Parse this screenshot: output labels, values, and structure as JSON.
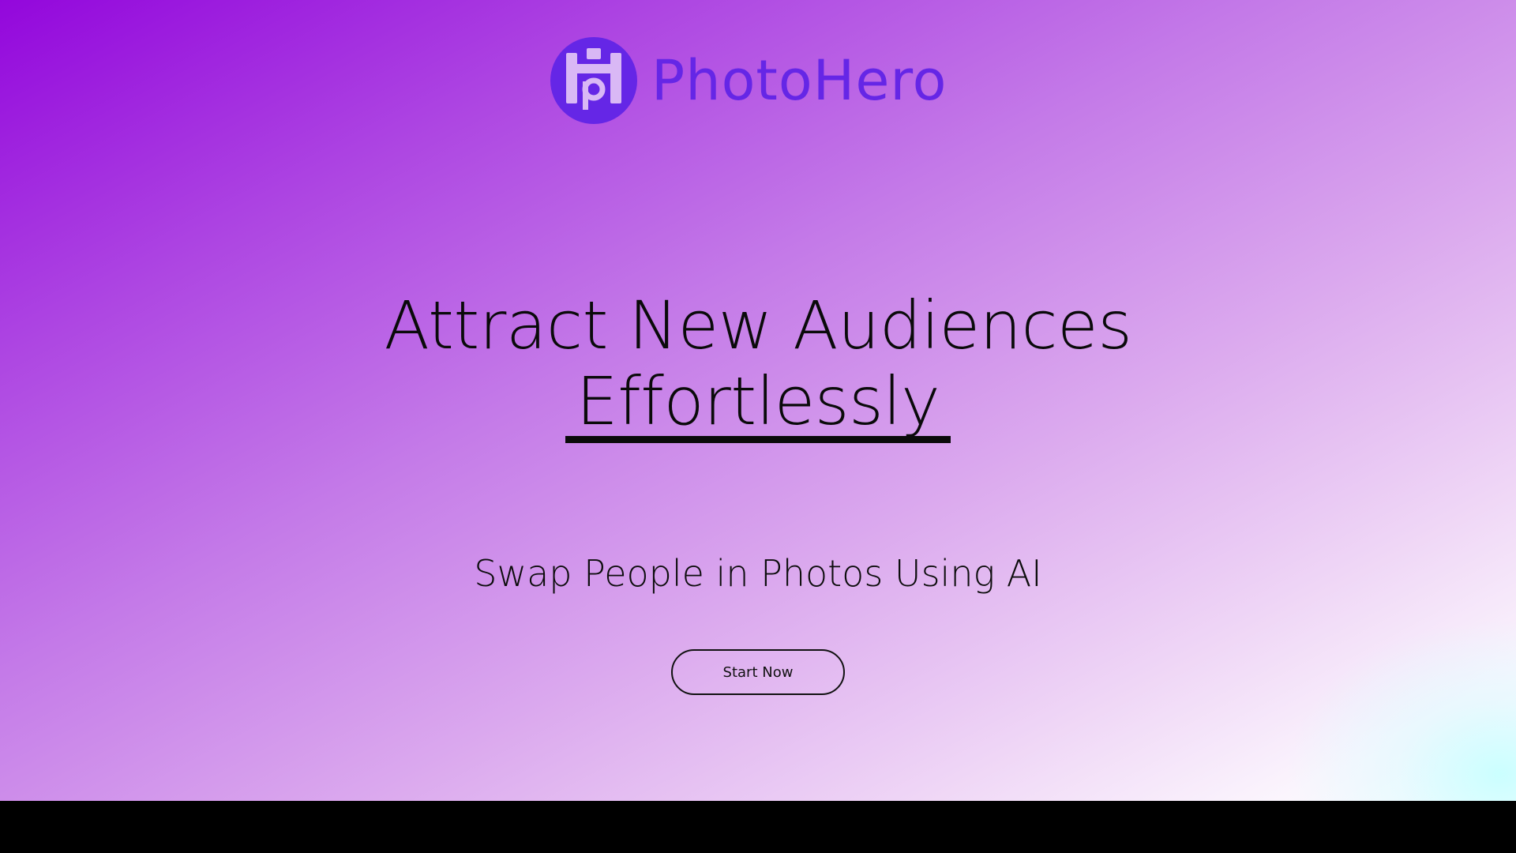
{
  "brand": {
    "name": "PhotoHero",
    "logo_icon": "photohero-logo-icon",
    "color": "#6526e6"
  },
  "hero": {
    "headline_line1": "Attract New Audiences",
    "headline_line2": "Effortlessly",
    "subheadline": "Swap People in Photos Using AI",
    "cta_label": "Start Now"
  },
  "colors": {
    "gradient_start": "#9307dc",
    "gradient_mid": "#c47ae8",
    "gradient_end": "#ffffff",
    "text": "#0a0a0a"
  }
}
